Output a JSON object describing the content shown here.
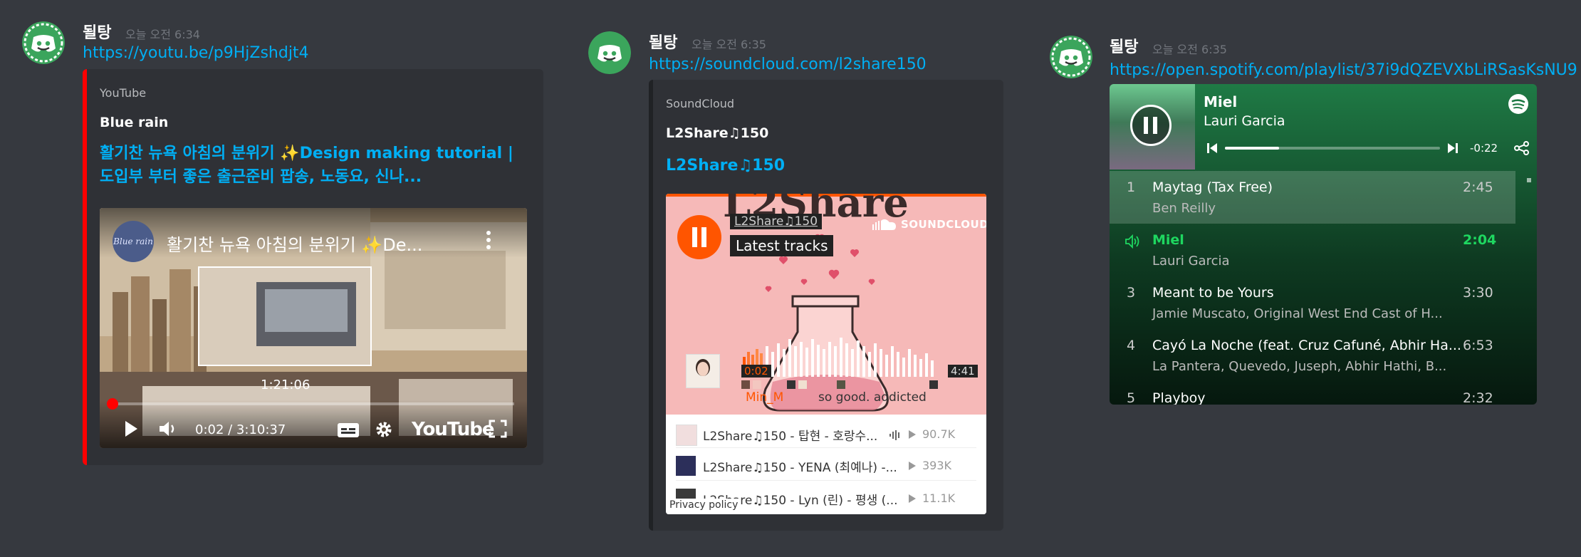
{
  "messages": [
    {
      "username": "될탕",
      "timestamp": "오늘 오전 6:34",
      "link": "https://youtu.be/p9HjZshdjt4",
      "embed": {
        "provider": "YouTube",
        "author": "Blue rain",
        "title": "활기찬 뉴욕 아침의 분위기 ✨Design making tutorial | 도입부 부터 좋은 출근준비 팝송, 노동요, 신나...",
        "player": {
          "overlay_title": "활기찬 뉴욕 아침의 분위기 ✨De...",
          "channel_badge": "Blue rain",
          "hover_time": "1:21:06",
          "time": "0:02 / 3:10:37",
          "logo": "YouTube",
          "progress": 0.0002
        }
      }
    },
    {
      "username": "될탕",
      "timestamp": "오늘 오전 6:35",
      "link": "https://soundcloud.com/l2share150",
      "embed": {
        "provider": "SoundCloud",
        "author": "L2Share♫150",
        "title": "L2Share♫150",
        "player": {
          "artwork_text": "L2Share",
          "user": "L2Share♫150",
          "headline": "Latest tracks",
          "brand": "SOUNDCLOUD",
          "time_start": "0:02",
          "time_end": "4:41",
          "comment_user": "Min_M",
          "comment_text": "so good. addicted",
          "tracks": [
            {
              "title": "L2Share♫150 - 탑현 - 호랑수...",
              "plays": "90.7K"
            },
            {
              "title": "L2Share♫150 - YENA (최예나) -...",
              "plays": "393K"
            },
            {
              "title": "L2Share♫150 - Lyn (린) - 평생 (...",
              "plays": "11.1K"
            }
          ],
          "privacy": "Privacy policy"
        }
      }
    },
    {
      "username": "될탕",
      "timestamp": "오늘 오전 6:35",
      "link": "https://open.spotify.com/playlist/37i9dQZEVXbLiRSasKsNU9",
      "embed": {
        "player": {
          "now_title": "Miel",
          "now_artist": "Lauri Garcia",
          "remaining": "-0:22",
          "progress": 0.25,
          "tracks": [
            {
              "num": "1",
              "title": "Maytag (Tax Free)",
              "artist": "Ben Reilly",
              "duration": "2:45"
            },
            {
              "num": "",
              "title": "Miel",
              "artist": "Lauri Garcia",
              "duration": "2:04"
            },
            {
              "num": "3",
              "title": "Meant to be Yours",
              "artist": "Jamie Muscato, Original West End Cast of H...",
              "duration": "3:30"
            },
            {
              "num": "4",
              "title": "Cayó La Noche (feat. Cruz Cafuné, Abhir Ha...",
              "artist": "La Pantera, Quevedo, Juseph, Abhir Hathi, B...",
              "duration": "6:53"
            },
            {
              "num": "5",
              "title": "Playboy",
              "artist": "",
              "duration": "2:32"
            }
          ]
        }
      }
    }
  ],
  "colors": {
    "background": "#36393f",
    "embed_bg": "#2f3136",
    "link": "#00aff4",
    "youtube_bar": "#ff0000",
    "soundcloud_bar": "#202225",
    "soundcloud_orange": "#ff5500",
    "spotify_green": "#1db954",
    "spotify_bg": "#1a6b3c"
  }
}
